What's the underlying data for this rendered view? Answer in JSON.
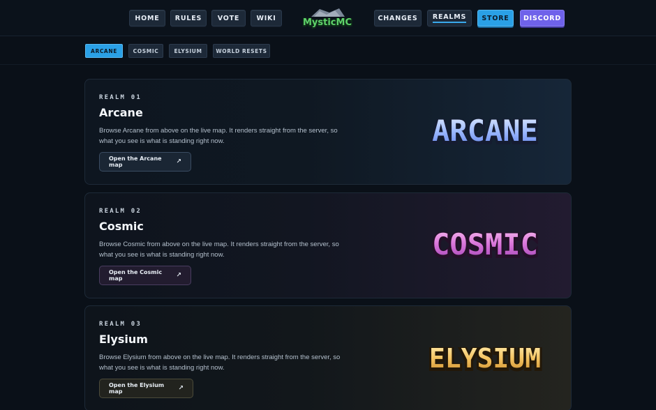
{
  "nav": {
    "left": [
      "HOME",
      "RULES",
      "VOTE",
      "WIKI"
    ],
    "right": [
      "CHANGES",
      "REALMS",
      "STORE",
      "DISCORD"
    ],
    "active": "REALMS",
    "logo_text": "MysticMC"
  },
  "subtabs": {
    "items": [
      "ARCANE",
      "COSMIC",
      "ELYSIUM",
      "WORLD RESETS"
    ],
    "active": "ARCANE"
  },
  "realms": [
    {
      "eyebrow": "REALM 01",
      "title": "Arcane",
      "description": "Browse Arcane from above on the live map. It renders straight from the server, so what you see is what is standing right now.",
      "button": "Open the Arcane map",
      "logo_text": "ARCANE",
      "colors": {
        "top": "#d9e6ff",
        "mid": "#8fb4ff",
        "bottom": "#5b7be6",
        "shadow": "#1a2440"
      }
    },
    {
      "eyebrow": "REALM 02",
      "title": "Cosmic",
      "description": "Browse Cosmic from above on the live map. It renders straight from the server, so what you see is what is standing right now.",
      "button": "Open the Cosmic map",
      "logo_text": "COSMIC",
      "colors": {
        "top": "#f7b2ee",
        "mid": "#d46bd6",
        "bottom": "#9b3fb0",
        "shadow": "#2a1230"
      }
    },
    {
      "eyebrow": "REALM 03",
      "title": "Elysium",
      "description": "Browse Elysium from above on the live map. It renders straight from the server, so what you see is what is standing right now.",
      "button": "Open the Elysium map",
      "logo_text": "ELYSIUM",
      "colors": {
        "top": "#ffe8a6",
        "mid": "#f4c05a",
        "bottom": "#c98a2a",
        "shadow": "#2a1e0a"
      }
    }
  ],
  "icons": {
    "button_arrow": "external-arrow-icon"
  }
}
